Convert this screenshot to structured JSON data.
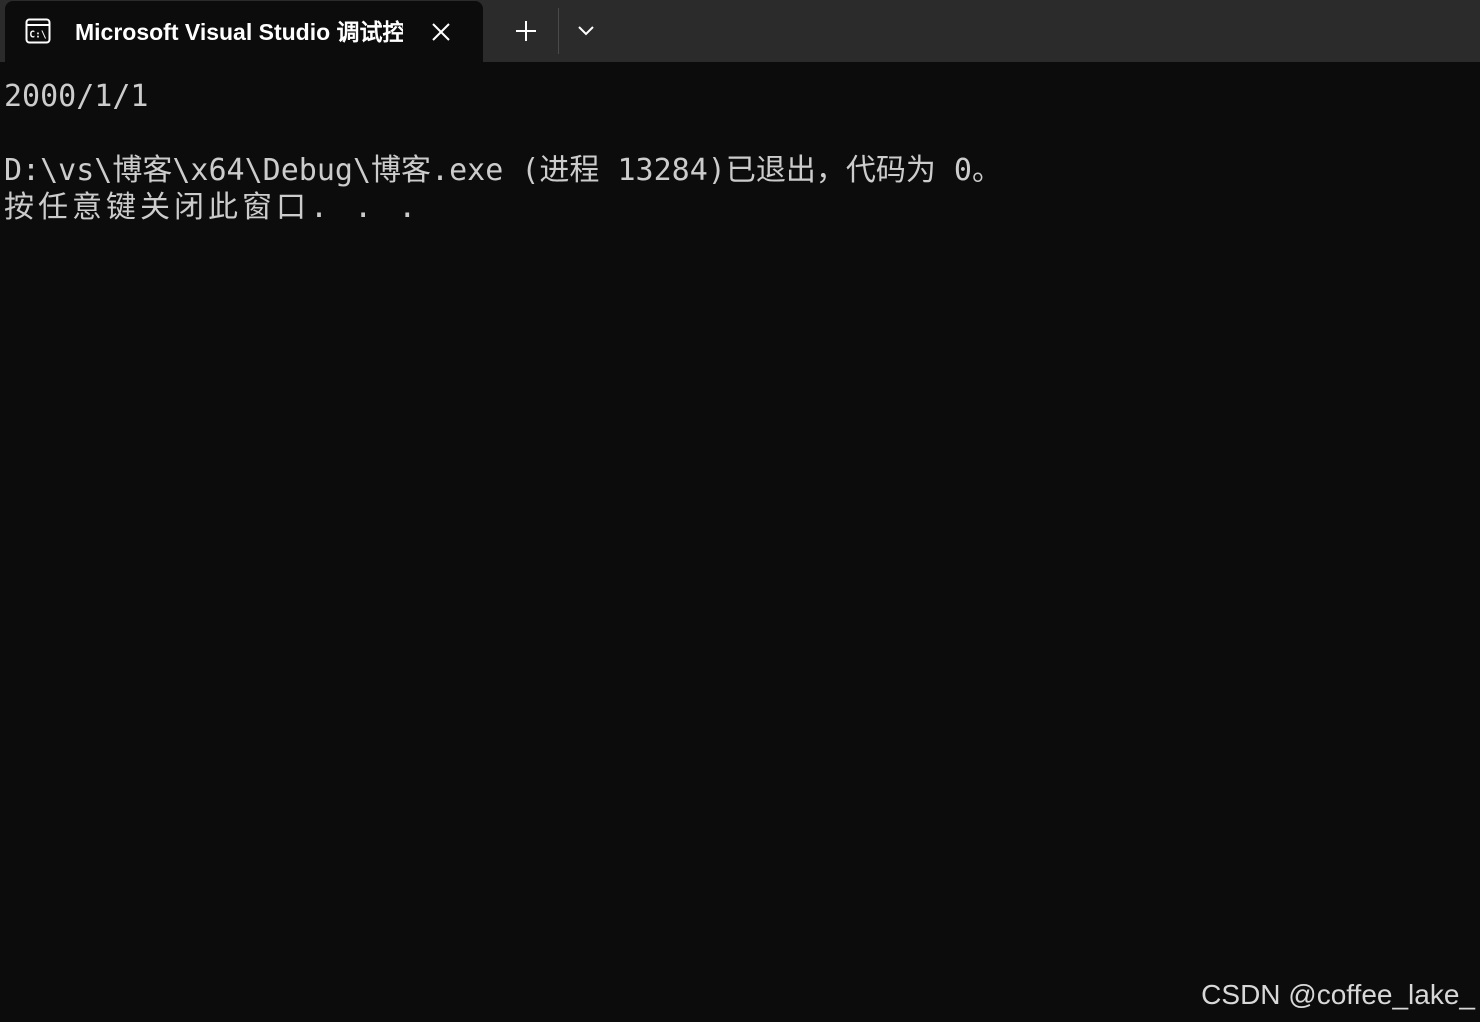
{
  "tab": {
    "icon": "terminal-app-icon",
    "title": "Microsoft Visual Studio 调试控制台",
    "close_icon": "close-icon",
    "new_tab_icon": "plus-icon",
    "dropdown_icon": "chevron-down-icon"
  },
  "console": {
    "lines": [
      "2000/1/1",
      "",
      "D:\\vs\\博客\\x64\\Debug\\博客.exe (进程 13284)已退出，代码为 0。",
      "按任意键关闭此窗口. . ."
    ]
  },
  "watermark": "CSDN @coffee_lake_",
  "colors": {
    "background": "#0c0c0c",
    "tabbar": "#2b2b2b",
    "text": "#cccccc"
  }
}
